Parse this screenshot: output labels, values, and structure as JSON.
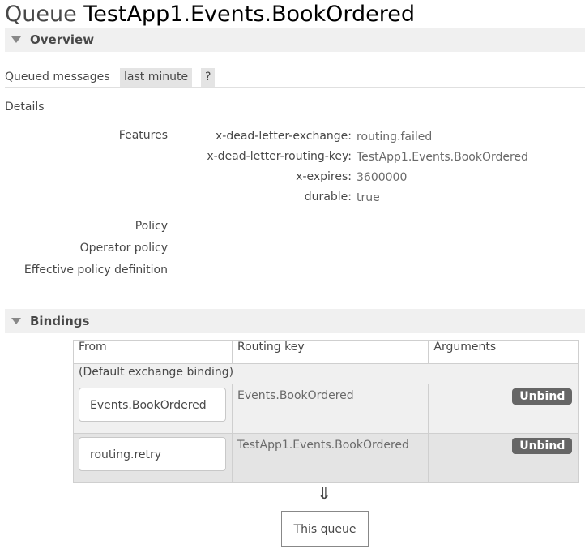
{
  "header": {
    "prefix": "Queue",
    "queue_name": "TestApp1.Events.BookOrdered"
  },
  "overview": {
    "section_label": "Overview",
    "queued_messages_label": "Queued messages",
    "range_option": "last minute",
    "help": "?"
  },
  "details": {
    "label": "Details",
    "features_label": "Features",
    "arguments": [
      {
        "key": "x-dead-letter-exchange:",
        "value": "routing.failed"
      },
      {
        "key": "x-dead-letter-routing-key:",
        "value": "TestApp1.Events.BookOrdered"
      },
      {
        "key": "x-expires:",
        "value": "3600000"
      },
      {
        "key": "durable:",
        "value": "true"
      }
    ],
    "policy_label": "Policy",
    "operator_policy_label": "Operator policy",
    "effective_policy_label": "Effective policy definition"
  },
  "bindings": {
    "section_label": "Bindings",
    "columns": [
      "From",
      "Routing key",
      "Arguments",
      ""
    ],
    "default_binding": "(Default exchange binding)",
    "rows": [
      {
        "from": "Events.BookOrdered",
        "routing_key": "Events.BookOrdered",
        "arguments": "",
        "action": "Unbind"
      },
      {
        "from": "routing.retry",
        "routing_key": "TestApp1.Events.BookOrdered",
        "arguments": "",
        "action": "Unbind"
      }
    ],
    "arrow": "⇓",
    "this_queue": "This queue"
  }
}
